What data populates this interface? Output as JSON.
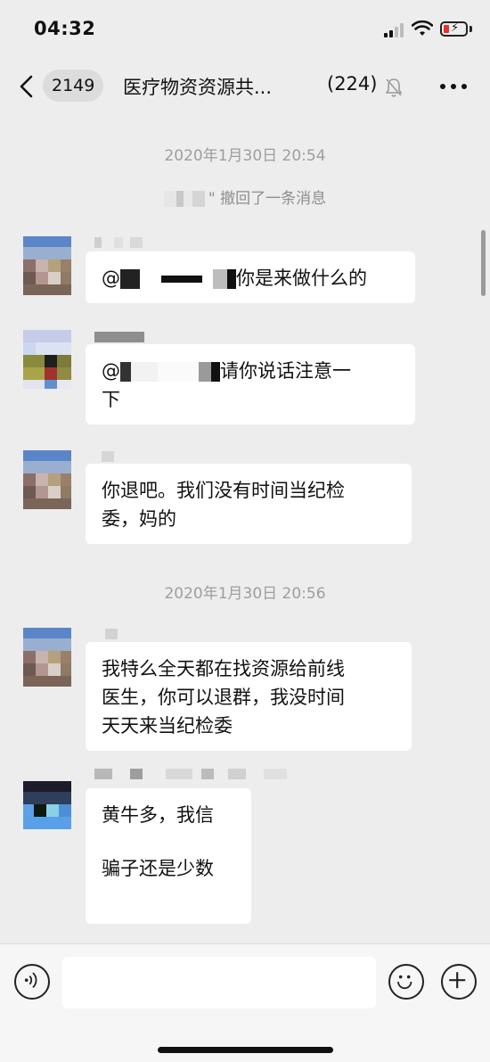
{
  "status_bar": {
    "time": "04:32"
  },
  "nav": {
    "back_count": "2149",
    "title": "医疗物资资源共...",
    "member_count": "(224)",
    "icons": {
      "back": "chevron-left-icon",
      "mute": "bell-off-icon",
      "more": "more-dots-icon"
    }
  },
  "messages": {
    "ts1": "2020年1月30日 20:54",
    "recall_text": "\" 撤回了一条消息",
    "m1": {
      "prefix": "@",
      "text": "你是来做什么的"
    },
    "m2": {
      "prefix": "@",
      "text": "请你说话注意一",
      "line2": "下"
    },
    "m3": {
      "line1": "你退吧。我们没有时间当纪检",
      "line2": "委，妈的"
    },
    "ts2": "2020年1月30日 20:56",
    "m4": {
      "line1": "我特么全天都在找资源给前线",
      "line2": "医生，你可以退群，我没时间",
      "line3": "天天来当纪检委"
    },
    "m5": {
      "line1": "黄牛多，我信",
      "line2": "骗子还是少数"
    }
  },
  "input_bar": {
    "icons": {
      "voice": "voice-icon",
      "emoji": "emoji-icon",
      "plus": "plus-icon"
    }
  }
}
